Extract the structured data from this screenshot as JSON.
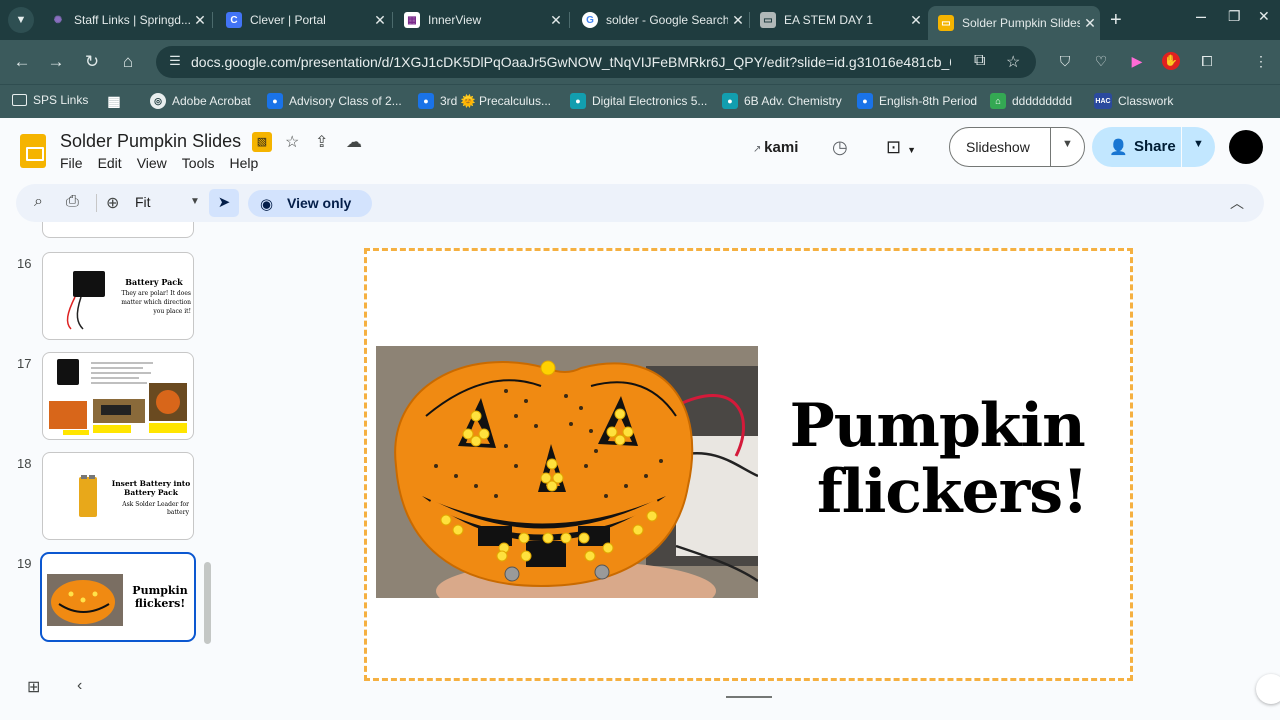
{
  "browser": {
    "tabs": [
      {
        "title": "Staff Links | Springd...",
        "icon": "sparkle-icon",
        "color": "#6b4fa0"
      },
      {
        "title": "Clever | Portal",
        "icon": "clever-c-icon",
        "color": "#4274f6"
      },
      {
        "title": "InnerView",
        "icon": "innerview-icon",
        "color": "#7a2a8c"
      },
      {
        "title": "solder - Google Search",
        "icon": "google-g-icon",
        "color": "#ffffff"
      },
      {
        "title": "EA STEM DAY 1",
        "icon": "slides-icon",
        "color": "#b0b8b8"
      },
      {
        "title": "Solder Pumpkin Slides",
        "icon": "slides-icon",
        "color": "#f5b400",
        "active": true
      }
    ],
    "url": "docs.google.com/presentation/d/1XGJ1cDK5DlPqOaaJr5GwNOW_tNqVIJFeBMRkr6J_QPY/edit?slide=id.g31016e481cb_0_...",
    "bookmarks": [
      {
        "label": "SPS Links",
        "icon": "folder-icon"
      },
      {
        "label": "",
        "icon": "apps-grid-icon"
      },
      {
        "label": "Adobe Acrobat",
        "icon": "adobe-acrobat-icon"
      },
      {
        "label": "Advisory Class of 2...",
        "icon": "classroom-icon"
      },
      {
        "label": "3rd 🌞 Precalculus...",
        "icon": "classroom-icon"
      },
      {
        "label": "Digital Electronics 5...",
        "icon": "classroom-icon"
      },
      {
        "label": "6B Adv. Chemistry",
        "icon": "classroom-icon"
      },
      {
        "label": "English-8th Period",
        "icon": "classroom-icon"
      },
      {
        "label": "ddddddddd",
        "icon": "house-icon"
      },
      {
        "label": "Classwork",
        "icon": "hac-icon"
      }
    ],
    "hac_label": "HAC"
  },
  "app": {
    "title": "Solder Pumpkin Slides",
    "menu": [
      "File",
      "Edit",
      "View",
      "Tools",
      "Help"
    ],
    "kami_label": "kami",
    "slideshow_label": "Slideshow",
    "share_label": "Share"
  },
  "toolbar": {
    "zoom_label": "Fit",
    "view_only_label": "View only"
  },
  "filmstrip": {
    "slides": [
      {
        "number": "16",
        "title": "Battery Pack",
        "body": "They are polar! It does matter which direction you place it!"
      },
      {
        "number": "17",
        "title": "",
        "body": ""
      },
      {
        "number": "18",
        "title": "Insert Battery into Battery Pack",
        "body": "Ask Solder Leader for battery"
      },
      {
        "number": "19",
        "title": "Pumpkin flickers!",
        "body": "",
        "selected": true
      }
    ]
  },
  "slide": {
    "line1": "Pumpkin",
    "line2": "flickers!"
  },
  "colors": {
    "accent": "#0b57d0",
    "share_bg": "#c2e7ff",
    "slide_border": "#f5b041",
    "pumpkin_orange": "#f08a12"
  }
}
